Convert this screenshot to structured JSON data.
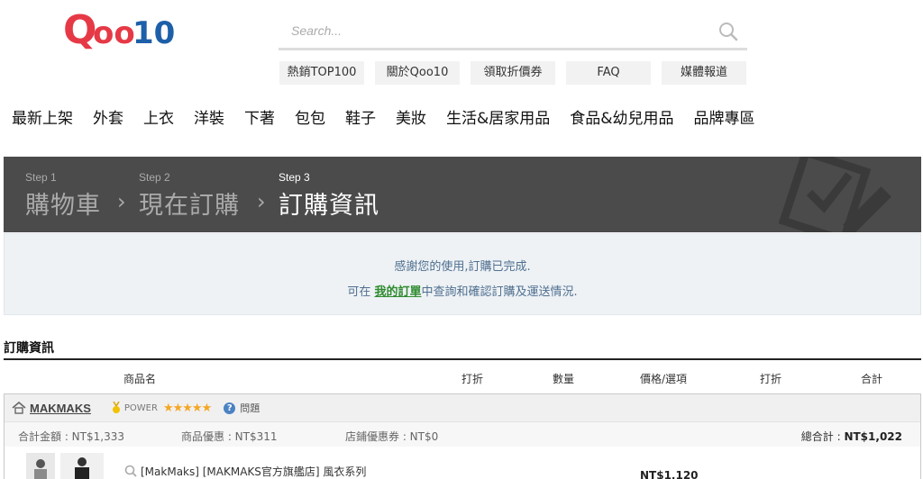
{
  "brand": {
    "logo_text": "Qoo10",
    "accent": "#e63946",
    "dark_text": "#1d5fa8"
  },
  "search": {
    "placeholder": "Search...",
    "icon": "search-icon"
  },
  "quick_links": [
    "熱銷TOP100",
    "關於Qoo10",
    "領取折價券",
    "FAQ",
    "媒體報道"
  ],
  "categories": [
    "最新上架",
    "外套",
    "上衣",
    "洋裝",
    "下著",
    "包包",
    "鞋子",
    "美妝",
    "生活&居家用品",
    "食品&幼兒用品",
    "品牌專區"
  ],
  "steps": [
    {
      "num": "Step 1",
      "title": "購物車"
    },
    {
      "num": "Step 2",
      "title": "現在訂購"
    },
    {
      "num": "Step 3",
      "title": "訂購資訊"
    }
  ],
  "thanks": {
    "line1": "感謝您的使用,訂購已完成.",
    "line2_before": "可在 ",
    "line2_link": "我的訂單",
    "line2_after": "中查詢和確認訂購及運送情況."
  },
  "order": {
    "section_title": "訂購資訊",
    "columns": [
      "商品名",
      "打折",
      "數量",
      "價格/選項",
      "打折",
      "合計"
    ],
    "shop": {
      "name": "MAKMAKS",
      "power_label": "POWER",
      "stars": "★★★★★",
      "question_label": "問題",
      "total_amount": "合計金額 : NT$1,333",
      "product_discount": "商品優惠 : NT$311",
      "store_coupon": "店鋪優惠券 : NT$0",
      "grand_total_label": "總合計 : ",
      "grand_total_value": "NT$1,022"
    },
    "item": {
      "name": "[MakMaks] [MAKMAKS官方旗艦店] 風衣系列",
      "price": "NT$1,120"
    }
  }
}
